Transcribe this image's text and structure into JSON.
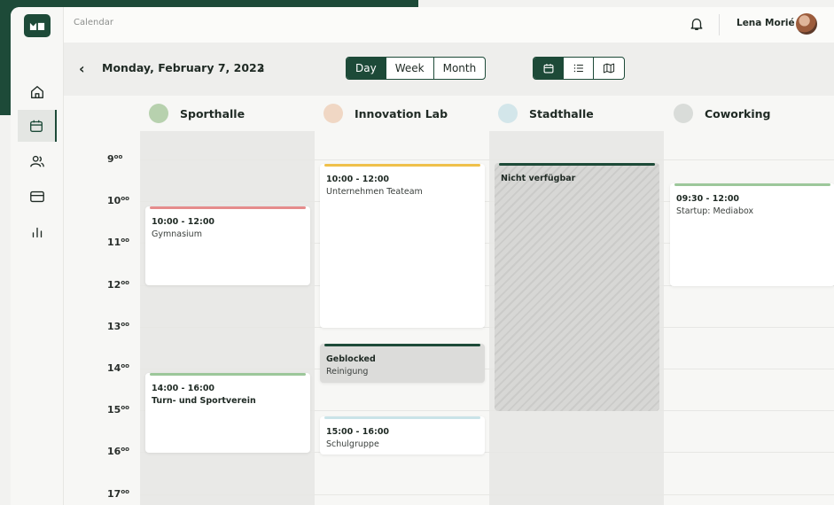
{
  "topbar": {
    "breadcrumb": "Calendar",
    "user_name": "Lena Morié"
  },
  "nav": {
    "items": [
      "home",
      "calendar",
      "users",
      "billing",
      "analytics"
    ],
    "active": "calendar"
  },
  "toolbar": {
    "date": "Monday, February 7, 2022",
    "view_options": [
      "Day",
      "Week",
      "Month"
    ],
    "active_view": "Day",
    "display_modes": [
      "calendar-icon",
      "list-icon",
      "map-icon"
    ],
    "active_display": "calendar-icon"
  },
  "colors": {
    "brand": "#1d4a38",
    "red": "#e58c8c",
    "yellow": "#efc04a",
    "green": "#9cc79a",
    "light_blue": "#c9e3e8",
    "dark": "#1d4a38"
  },
  "venues": [
    {
      "name": "Sporthalle",
      "dot": "#b7d1ae"
    },
    {
      "name": "Innovation Lab",
      "dot": "#f0d7c4"
    },
    {
      "name": "Stadthalle",
      "dot": "#d3e6ea"
    },
    {
      "name": "Coworking",
      "dot": "#d9dcd9"
    }
  ],
  "hours": [
    "9",
    "10",
    "11",
    "12",
    "13",
    "14",
    "15",
    "16",
    "17"
  ],
  "hour_suffix": "oo",
  "events": {
    "gymnasium": {
      "time": "10:00 - 12:00",
      "title": "Gymnasium"
    },
    "turnverein": {
      "time": "14:00 - 16:00",
      "title": "Turn- und Sportverein"
    },
    "unternehmen": {
      "time": "10:00 - 12:00",
      "title": "Unternehmen Teateam"
    },
    "geblocked": {
      "time": "Geblocked",
      "title": "Reinigung"
    },
    "schulgruppe": {
      "time": "15:00 - 16:00",
      "title": "Schulgruppe"
    },
    "nicht": {
      "title": "Nicht verfügbar"
    },
    "startup": {
      "time": "09:30 - 12:00",
      "title": "Startup: Mediabox"
    }
  }
}
